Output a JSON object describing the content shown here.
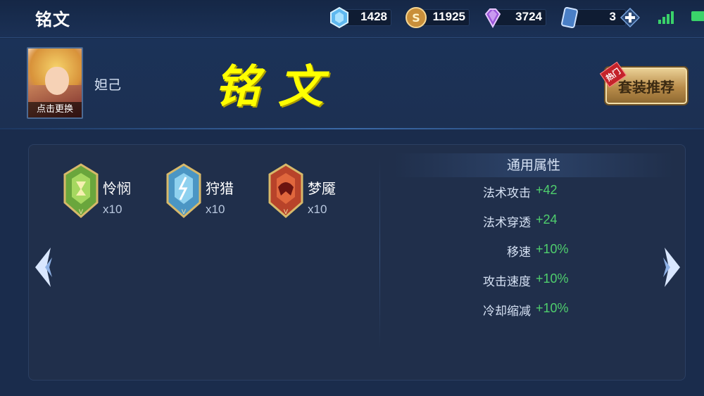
{
  "topbar": {
    "title": "铭文",
    "currencies": [
      {
        "icon": "crystal-icon",
        "value": "1428"
      },
      {
        "icon": "gold-coin-icon",
        "value": "11925"
      },
      {
        "icon": "diamond-icon",
        "value": "3724"
      },
      {
        "icon": "card-ticket-icon",
        "value": "3"
      }
    ]
  },
  "hero": {
    "name": "妲己",
    "change_label": "点击更换"
  },
  "page_heading": "铭文",
  "recommend": {
    "label": "套装推荐",
    "hot_badge": "热门"
  },
  "runes": [
    {
      "name": "怜悯",
      "count": "x10",
      "icon": "mercy-rune-icon"
    },
    {
      "name": "狩猎",
      "count": "x10",
      "icon": "hunt-rune-icon"
    },
    {
      "name": "梦魇",
      "count": "x10",
      "icon": "nightmare-rune-icon"
    }
  ],
  "attributes": {
    "title": "通用属性",
    "items": [
      {
        "key": "法术攻击",
        "value": "+42"
      },
      {
        "key": "法术穿透",
        "value": "+24"
      },
      {
        "key": "移速",
        "value": "+10%"
      },
      {
        "key": "攻击速度",
        "value": "+10%"
      },
      {
        "key": "冷却缩减",
        "value": "+10%"
      }
    ]
  },
  "colors": {
    "accent_yellow": "#ffff00",
    "attr_green": "#4fcf6d",
    "panel_bg": "#202f4b"
  }
}
